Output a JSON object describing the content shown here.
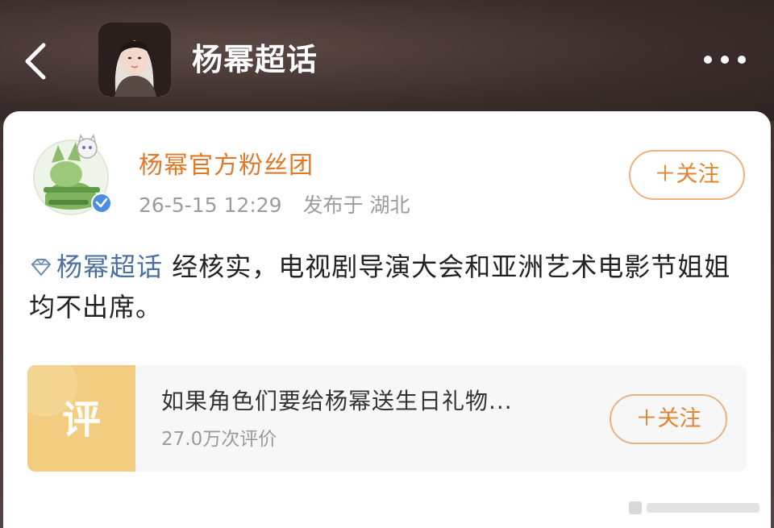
{
  "header": {
    "title": "杨幂超话",
    "back_icon": "chevron-left-icon",
    "more_icon": "ellipsis-horizontal-icon"
  },
  "post": {
    "author": "杨幂官方粉丝团",
    "timestamp": "26-5-15 12:29",
    "location": "发布于 湖北",
    "follow_label": "＋关注",
    "topic_icon": "diamond-icon",
    "topic": "杨幂超话",
    "text": "经核实，电视剧导演大会和亚洲艺术电影节姐姐均不出席。",
    "verified_icon": "verified-badge-icon"
  },
  "review_card": {
    "thumb_glyph": "评",
    "title": "如果角色们要给杨幂送生日礼物...",
    "count": "27.0万次评价",
    "follow_label": "＋关注"
  },
  "colors": {
    "accent_orange": "#e07a28",
    "topic_blue": "#4a6fa0",
    "header_bg": "#3a2c2a"
  }
}
